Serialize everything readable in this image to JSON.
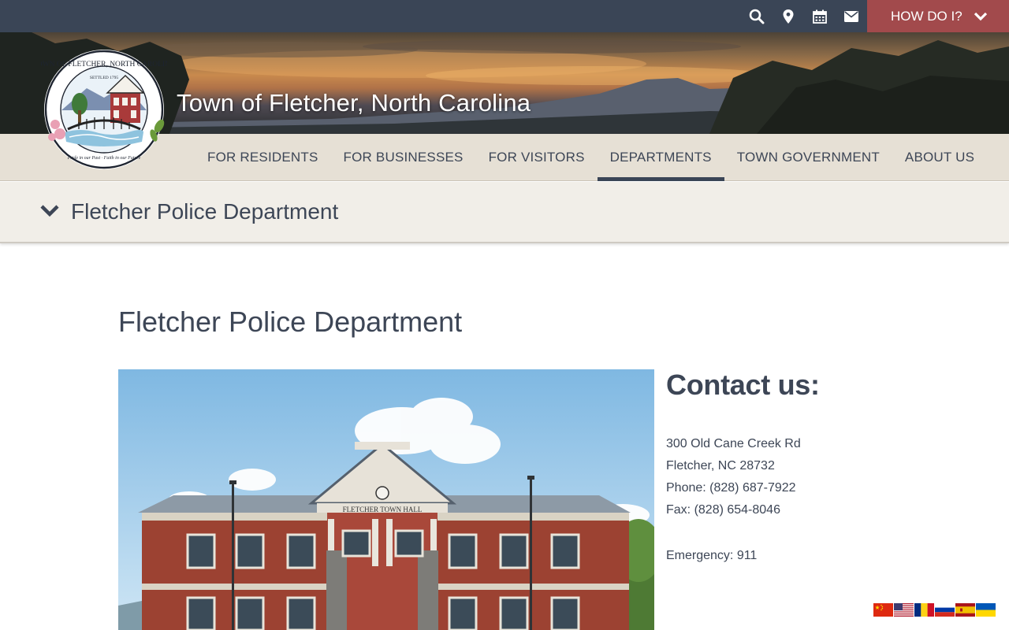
{
  "header": {
    "utility_icons": [
      {
        "name": "search-icon"
      },
      {
        "name": "map-marker-icon"
      },
      {
        "name": "calendar-icon"
      },
      {
        "name": "envelope-icon"
      }
    ],
    "how_do_i_label": "HOW DO I?",
    "site_title": "Town of Fletcher, North Carolina",
    "colors": {
      "topbar": "#3a4556",
      "how_do_i": "#a24a4c",
      "nav_bg": "#e6e0d5"
    }
  },
  "logo": {
    "seal_text": "TOWN OF FLETCHER, NORTH CAROLINA",
    "settled": "SETTLED 1795",
    "motto": "Pride in our Past · Faith in our Future"
  },
  "nav": {
    "items": [
      {
        "label": "FOR RESIDENTS"
      },
      {
        "label": "FOR BUSINESSES"
      },
      {
        "label": "FOR VISITORS"
      },
      {
        "label": "DEPARTMENTS",
        "active": true
      },
      {
        "label": "TOWN GOVERNMENT"
      },
      {
        "label": "ABOUT US"
      }
    ]
  },
  "breadcrumb": {
    "label": "Fletcher Police Department"
  },
  "main": {
    "title": "Fletcher Police Department",
    "photo_sign": "FLETCHER TOWN HALL",
    "contact": {
      "heading": "Contact us:",
      "address1": "300 Old Cane Creek Rd",
      "address2": "Fletcher, NC 28732",
      "phone": "Phone: (828) 687-7922",
      "fax": "Fax: (828) 654-8046",
      "emergency": "Emergency: 911"
    }
  },
  "translate_flags": [
    "Chinese",
    "English",
    "Romanian",
    "Russian",
    "Spanish",
    "Ukrainian"
  ]
}
